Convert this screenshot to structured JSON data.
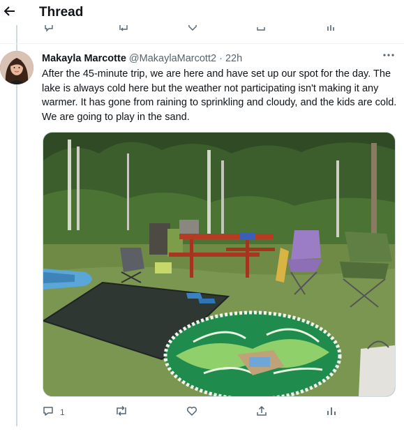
{
  "header": {
    "title": "Thread",
    "back_icon": "arrow-left-icon"
  },
  "tweet": {
    "display_name": "Makayla Marcotte",
    "handle": "@MakaylaMarcott2",
    "separator": "·",
    "time": "22h",
    "more_icon": "more-horizontal-icon",
    "text": "After the 45-minute trip, we are here and have set up our spot for the day. The lake is always cold here but the weather not participating isn't making it any warmer. It has gone from raining to sprinkling and cloudy, and the kids are cold. We are going to play in the sand.",
    "actions": {
      "reply_count": "1",
      "reply_icon": "reply-icon",
      "retweet_icon": "retweet-icon",
      "like_icon": "heart-icon",
      "share_icon": "share-icon",
      "analytics_icon": "analytics-icon"
    }
  },
  "colors": {
    "text": "#0f1419",
    "secondary": "#536471",
    "thread_line": "#cfd9de",
    "grass": "#5f7a3a"
  }
}
